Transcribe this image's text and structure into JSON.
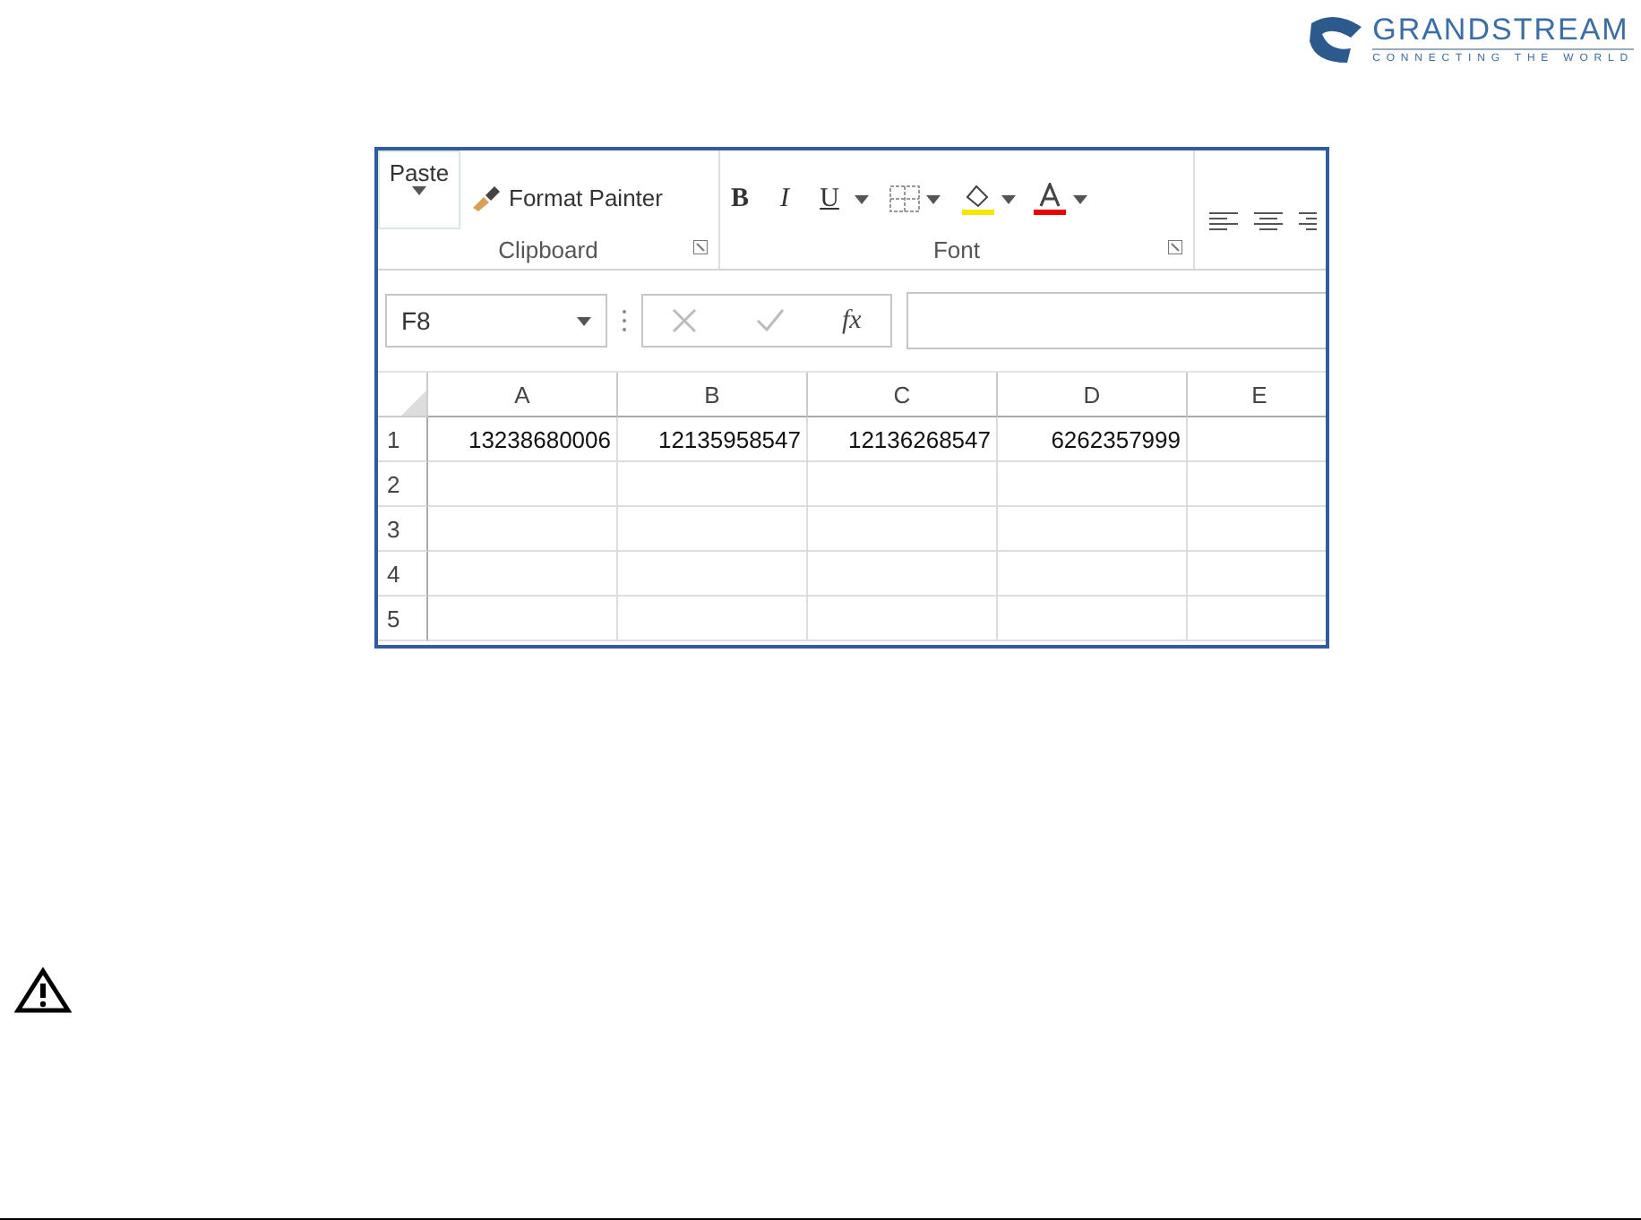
{
  "logo": {
    "name": "GRANDSTREAM",
    "tagline": "CONNECTING THE WORLD"
  },
  "ribbon": {
    "paste": "Paste",
    "format_painter": "Format Painter",
    "font_buttons": [
      "B",
      "I",
      "U"
    ],
    "groups": [
      "Clipboard",
      "Font"
    ]
  },
  "formula_bar": {
    "name_box": "F8",
    "function_label": "fx"
  },
  "sheet": {
    "columns": [
      "A",
      "B",
      "C",
      "D",
      "E"
    ],
    "rows": [
      {
        "label": "1",
        "cells": [
          "13238680006",
          "12135958547",
          "12136268547",
          "6262357999",
          ""
        ]
      },
      {
        "label": "2",
        "cells": [
          "",
          "",
          "",
          "",
          ""
        ]
      },
      {
        "label": "3",
        "cells": [
          "",
          "",
          "",
          "",
          ""
        ]
      },
      {
        "label": "4",
        "cells": [
          "",
          "",
          "",
          "",
          ""
        ]
      },
      {
        "label": "5",
        "cells": [
          "",
          "",
          "",
          "",
          ""
        ]
      }
    ]
  }
}
